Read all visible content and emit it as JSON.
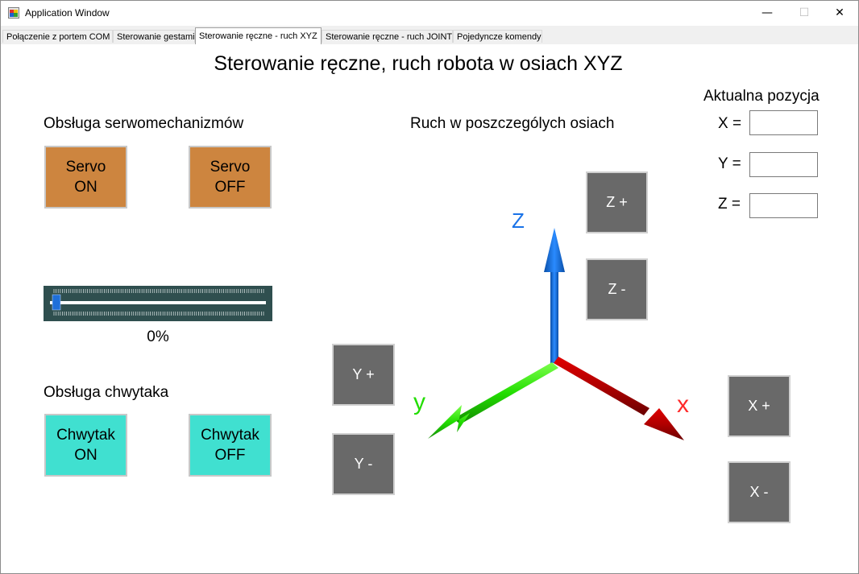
{
  "window": {
    "title": "Application Window",
    "minimize": "—",
    "maximize": "☐",
    "close": "✕"
  },
  "tabs": [
    {
      "label": "Połączenie z portem COM",
      "active": false
    },
    {
      "label": "Sterowanie gestami",
      "active": false
    },
    {
      "label": "Sterowanie ręczne - ruch XYZ",
      "active": true
    },
    {
      "label": "Sterowanie ręczne - ruch JOINT",
      "active": false
    },
    {
      "label": "Pojedyncze komendy",
      "active": false
    }
  ],
  "page": {
    "title": "Sterowanie ręczne, ruch robota w osiach XYZ"
  },
  "servo": {
    "heading": "Obsługa serwomechanizmów",
    "on": {
      "line1": "Servo",
      "line2": "ON"
    },
    "off": {
      "line1": "Servo",
      "line2": "OFF"
    },
    "color": "#cd853f"
  },
  "speed_slider": {
    "value": 0,
    "label": "0%",
    "color": "#2f4f4f",
    "thumb_color": "#1e6fd9"
  },
  "gripper": {
    "heading": "Obsługa chwytaka",
    "on": {
      "line1": "Chwytak",
      "line2": "ON"
    },
    "off": {
      "line1": "Chwytak",
      "line2": "OFF"
    },
    "color": "#40e0d0"
  },
  "axes_section": {
    "heading": "Ruch w poszczególych osiach",
    "axis_labels": {
      "x": "x",
      "y": "y",
      "z": "Z"
    },
    "axis_colors": {
      "x": "#cc0000",
      "y": "#22dd00",
      "z": "#1a73e8"
    },
    "buttons": {
      "z_plus": "Z +",
      "z_minus": "Z -",
      "y_plus": "Y +",
      "y_minus": "Y -",
      "x_plus": "X +",
      "x_minus": "X -"
    },
    "button_color": "#696969"
  },
  "position": {
    "heading": "Aktualna pozycja",
    "x_label": "X =",
    "y_label": "Y =",
    "z_label": "Z =",
    "x_value": "",
    "y_value": "",
    "z_value": ""
  }
}
